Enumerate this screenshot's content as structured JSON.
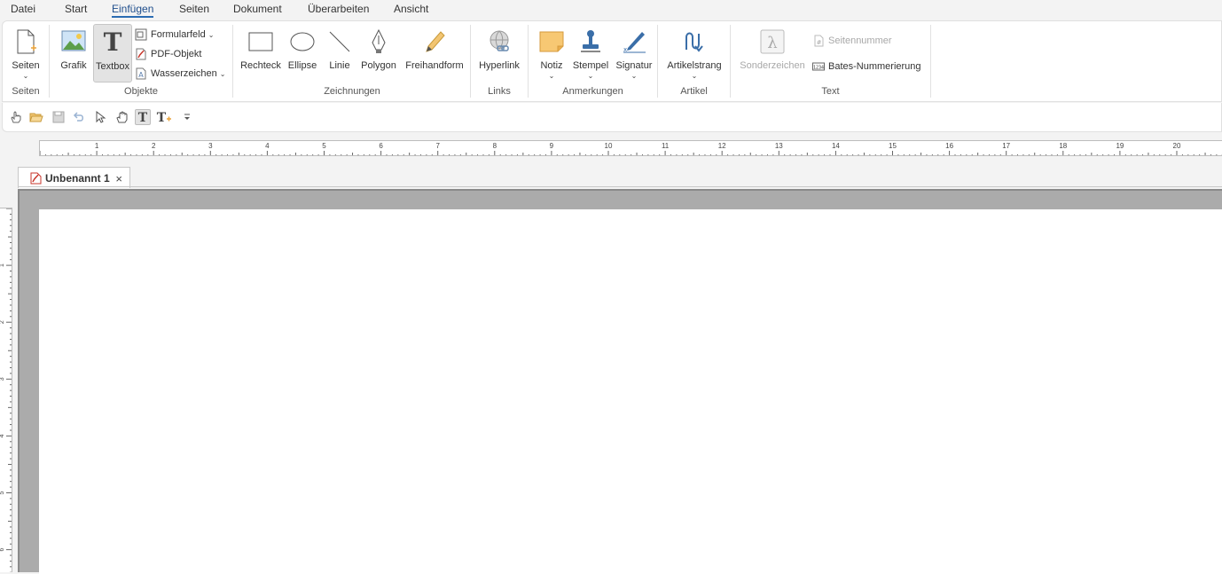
{
  "menu": {
    "items": [
      "Datei",
      "Start",
      "Einfügen",
      "Seiten",
      "Dokument",
      "Überarbeiten",
      "Ansicht"
    ],
    "active": "Einfügen"
  },
  "ribbon": {
    "seiten": {
      "button": "Seiten",
      "group": "Seiten"
    },
    "objekte": {
      "grafik": "Grafik",
      "textbox": "Textbox",
      "formularfeld": "Formularfeld",
      "pdf_objekt": "PDF-Objekt",
      "wasserzeichen": "Wasserzeichen",
      "group": "Objekte"
    },
    "zeichnungen": {
      "rechteck": "Rechteck",
      "ellipse": "Ellipse",
      "linie": "Linie",
      "polygon": "Polygon",
      "freihandform": "Freihandform",
      "group": "Zeichnungen"
    },
    "links": {
      "hyperlink": "Hyperlink",
      "group": "Links"
    },
    "anmerkungen": {
      "notiz": "Notiz",
      "stempel": "Stempel",
      "signatur": "Signatur",
      "group": "Anmerkungen"
    },
    "artikel": {
      "artikelstrang": "Artikelstrang",
      "group": "Artikel"
    },
    "text": {
      "sonderzeichen": "Sonderzeichen",
      "seitennummer": "Seitennummer",
      "bates": "Bates-Nummerierung",
      "bates_icon_text": "1234",
      "group": "Text"
    }
  },
  "quick_access": {
    "icons": [
      "hand-pointer-icon",
      "open-folder-icon",
      "save-icon",
      "undo-icon",
      "select-arrow-icon",
      "pan-hand-icon",
      "text-tool-icon",
      "text-add-icon",
      "customize-dropdown-icon"
    ]
  },
  "ruler": {
    "horizontal_numbers": [
      "1",
      "2",
      "3",
      "4",
      "5",
      "6",
      "7",
      "8",
      "9",
      "10",
      "11",
      "12",
      "13",
      "14",
      "15",
      "16",
      "17",
      "18",
      "19",
      "20"
    ],
    "vertical_numbers": [
      "1",
      "2",
      "3",
      "4",
      "5",
      "6"
    ]
  },
  "document": {
    "tab_title": "Unbenannt 1",
    "close_glyph": "×"
  },
  "colors": {
    "accent": "#2b6cb3",
    "workspace": "#ababab",
    "note_yellow": "#f7c873",
    "pdf_red": "#c8352b"
  }
}
